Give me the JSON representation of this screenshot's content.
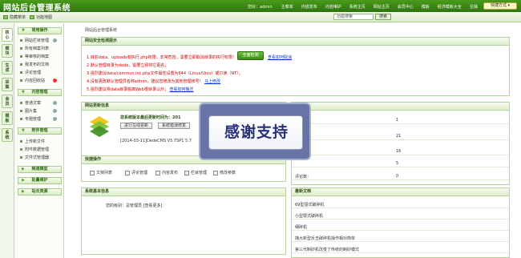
{
  "app": {
    "title": "网站后台管理系统",
    "style_switch": "快捷方式 ▾"
  },
  "topnav": {
    "user": "您好：admin",
    "items": [
      "主菜单",
      "内容发布",
      "内容维护",
      "系统主页",
      "网站主页",
      "会员中心",
      "模板",
      "经济模板大全",
      "注销"
    ]
  },
  "subbar": {
    "desktop": "隐藏菜单",
    "map": "功能地图",
    "search_value": "功能搜索",
    "search_btn": "搜索"
  },
  "vtabs": [
    "核心",
    "模块",
    "生成",
    "采集",
    "会员",
    "模板",
    "系统"
  ],
  "sidebar": {
    "groups": [
      {
        "title": "常用操作",
        "items": [
          "网站栏目管理",
          "所有档案列表",
          "等审核的档案",
          "我发布的文档",
          "评论管理",
          "内容回收站"
        ]
      },
      {
        "title": "内容管理",
        "items": [
          "普通文章",
          "图片集",
          "专题管理"
        ]
      },
      {
        "title": "附件管理",
        "items": [
          "上传新文件",
          "附件数据管理",
          "文件式管理器"
        ]
      },
      {
        "title": "频道模型",
        "items": []
      },
      {
        "title": "批量维护",
        "items": []
      },
      {
        "title": "站长资源",
        "items": []
      }
    ]
  },
  "main": {
    "breadcrumb": "网站后台管理系统",
    "security": {
      "title": "网站安全检测提示",
      "lines": [
        "1.目前data、uploads有执行.php权限，非常危险，需要立即取消目录的执行权限！",
        "2.默认管理目录为dede，需要立即将它更名；",
        "3.强烈建议data/common.inc.php文件属性设置为644（Linux/Unix）或只读（NT）；",
        "4.没有更改默认管理员名称admin，建议您修改为其他管理帐号！",
        "5.强烈建议将data目录搬离Web根目录以外；"
      ],
      "link4": "马上修改",
      "link5": "查看如何搬迁",
      "check_btn": "全面检测",
      "readme": "查看如何取消"
    },
    "update": {
      "title": "网站更新信息",
      "status": "您系统版本最后更新时间为：201",
      "btn_check": "进行在线更新",
      "btn_log": "系统错误修复",
      "log": "[2014-03-11]DedeCMS V5.7SP1 5.7"
    },
    "quick": {
      "title": "快捷操作",
      "items": [
        "文档列表",
        "评论管理",
        "内容发布",
        "栏目管理",
        "修改参数"
      ]
    },
    "sysinfo": {
      "title": "系统基本信息",
      "line": "您的级别：总管理员 [查看更多]"
    },
    "stats": {
      "rows": [
        {
          "label": "",
          "value": "1"
        },
        {
          "label": "",
          "value": "21"
        },
        {
          "label": "",
          "value": "16"
        },
        {
          "label": "",
          "value": "5"
        },
        {
          "label": "评论数：",
          "value": "0"
        }
      ]
    },
    "latest": {
      "title": "最新文档",
      "items": [
        "69型颚式破碎机",
        "小型颚式破碎机",
        "细碎机",
        "拽大新型反击破碎机操作相对简单",
        "第三代制砂机改变了传统的制砂模式"
      ]
    },
    "overlay": {
      "text": "感谢支持"
    }
  }
}
